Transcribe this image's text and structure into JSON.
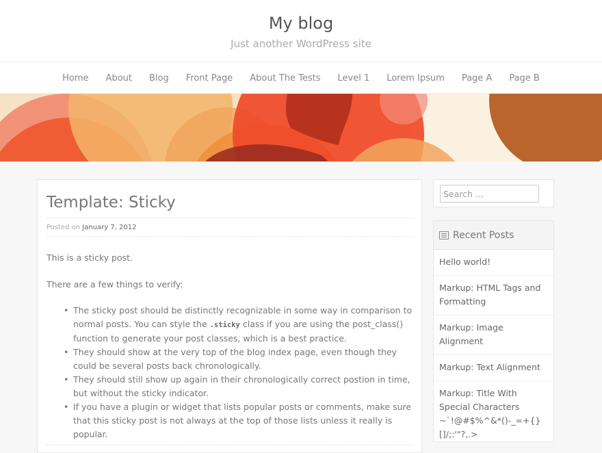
{
  "header": {
    "site_title": "My blog",
    "tagline": "Just another WordPress site"
  },
  "nav": {
    "items": [
      "Home",
      "About",
      "Blog",
      "Front Page",
      "About The Tests",
      "Level 1",
      "Lorem Ipsum",
      "Page A",
      "Page B"
    ]
  },
  "post": {
    "title": "Template: Sticky",
    "meta_prefix": "Posted on",
    "date": "January 7, 2012",
    "intro": "This is a sticky post.",
    "verify_text": "There are a few things to verify:",
    "bullets": [
      {
        "before": "The sticky post should be distinctly recognizable in some way in comparison to normal posts. You can style the ",
        "code": ".sticky",
        "after": " class if you are using the post_class() function to generate your post classes, which is a best practice."
      },
      {
        "before": "They should show at the very top of the blog index page, even though they could be several posts back chronologically.",
        "code": "",
        "after": ""
      },
      {
        "before": "They should still show up again in their chronologically correct postion in time, but without the sticky indicator.",
        "code": "",
        "after": ""
      },
      {
        "before": "If you have a plugin or widget that lists popular posts or comments, make sure that this sticky post is not always at the top of those lists unless it really is popular.",
        "code": "",
        "after": ""
      }
    ]
  },
  "sidebar": {
    "search_placeholder": "Search …",
    "recent_title": "Recent Posts",
    "recent_icon": "document-icon",
    "recent_posts": [
      "Hello world!",
      "Markup: HTML Tags and Formatting",
      "Markup: Image Alignment",
      "Markup: Text Alignment",
      "Markup: Title With Special Characters ~`!@#$%^&*()-_=+{}[]/;:'\"?,.>"
    ]
  },
  "colors": {
    "hero_bg": "#f6e2c4",
    "orange": "#ef6b2f",
    "light_orange": "#f3b46a",
    "red": "#e8482a",
    "brown": "#b9652c"
  }
}
